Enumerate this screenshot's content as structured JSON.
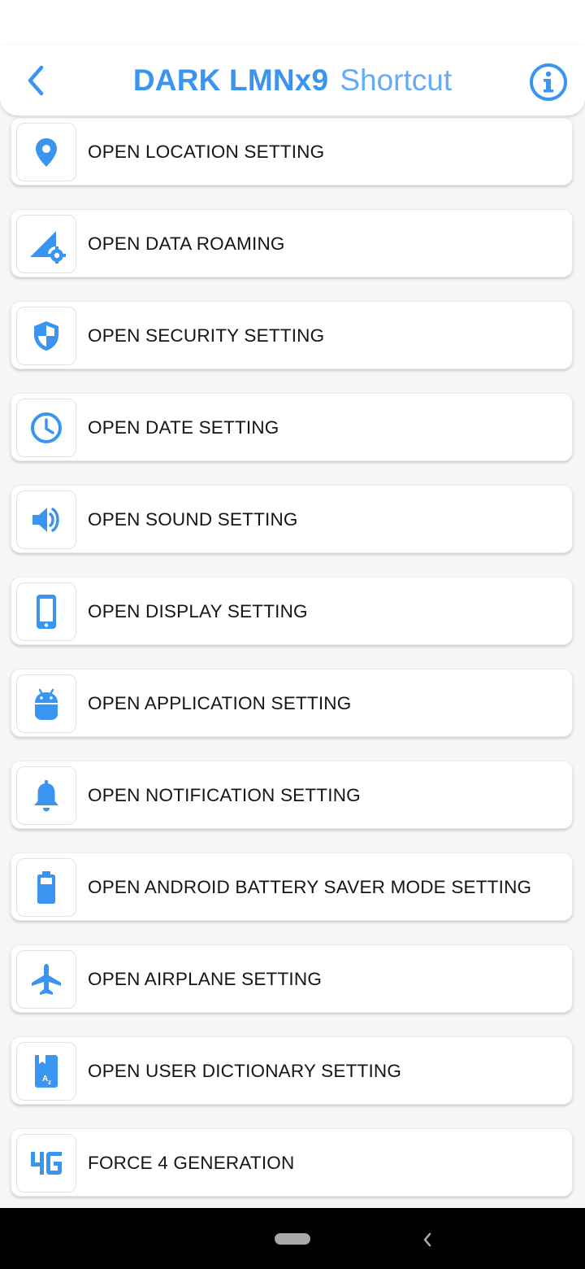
{
  "header": {
    "title": "DARK LMNx9",
    "subtitle": "Shortcut",
    "back_icon": "chevron-left-icon",
    "info_icon": "info-circle-icon"
  },
  "colors": {
    "accent": "#3a95f0",
    "accent_light": "#64acf5",
    "background": "#f8f5f8",
    "card": "#ffffff",
    "nav_bar": "#000000"
  },
  "items": [
    {
      "label": "OPEN LOCATION SETTING",
      "icon": "location-pin-icon"
    },
    {
      "label": "OPEN DATA ROAMING",
      "icon": "signal-settings-icon"
    },
    {
      "label": "OPEN SECURITY SETTING",
      "icon": "shield-icon"
    },
    {
      "label": "OPEN DATE SETTING",
      "icon": "clock-icon"
    },
    {
      "label": "OPEN SOUND SETTING",
      "icon": "volume-icon"
    },
    {
      "label": "OPEN DISPLAY SETTING",
      "icon": "phone-icon"
    },
    {
      "label": "OPEN APPLICATION SETTING",
      "icon": "android-icon"
    },
    {
      "label": "OPEN NOTIFICATION SETTING",
      "icon": "bell-icon"
    },
    {
      "label": "OPEN ANDROID BATTERY SAVER MODE SETTING",
      "icon": "battery-icon"
    },
    {
      "label": "OPEN AIRPLANE SETTING",
      "icon": "airplane-icon"
    },
    {
      "label": "OPEN USER DICTIONARY SETTING",
      "icon": "dictionary-icon"
    },
    {
      "label": "FORCE 4 GENERATION",
      "icon": "4g-icon"
    }
  ]
}
